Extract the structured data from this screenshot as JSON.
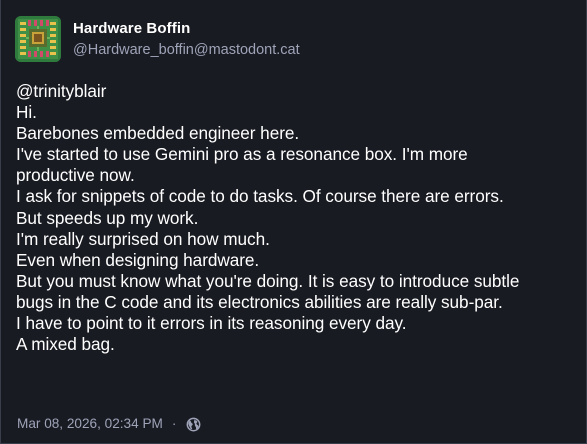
{
  "author": {
    "display_name": "Hardware Boffin",
    "handle": "@Hardware_boffin@mastodont.cat",
    "avatar_icon": "circuit-board-avatar-icon"
  },
  "post": {
    "mention": "@trinityblair",
    "lines": [
      "Hi.",
      "Barebones embedded engineer here.",
      "I've started to use Gemini pro as a resonance box. I'm more",
      "productive now.",
      "I ask for snippets of code to do tasks. Of course there are errors.",
      "But speeds up my work.",
      "I'm really surprised on how much.",
      "Even when designing hardware.",
      "But you must know what you're doing. It is easy to introduce subtle",
      "bugs in the C code and its electronics abilities are really sub-par.",
      "I have to point to it errors in its reasoning every day.",
      "A mixed bag."
    ]
  },
  "footer": {
    "timestamp": "Mar 08, 2026, 02:34 PM",
    "separator": "·",
    "visibility_icon": "globe-icon"
  },
  "colors": {
    "background": "#191b22",
    "text": "#ffffff",
    "muted": "#9ea3b8",
    "border": "#3a3d4a"
  }
}
